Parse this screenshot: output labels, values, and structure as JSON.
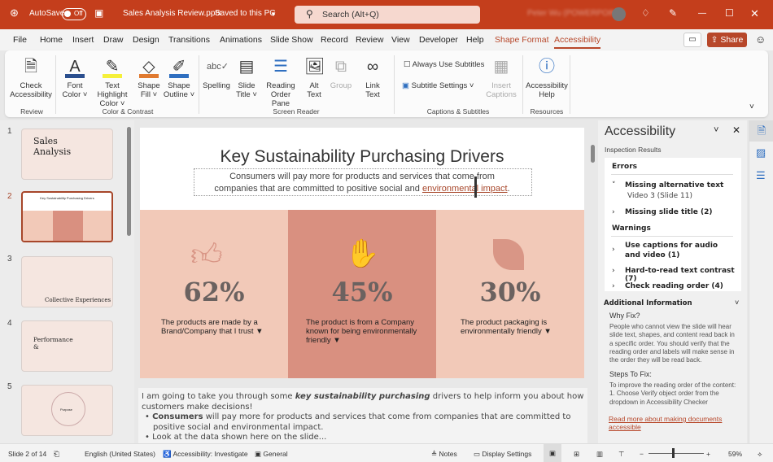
{
  "titlebar": {
    "autosave_label": "AutoSave",
    "autosave_state": "Off",
    "file_title": "Sales Analysis Review.pptx",
    "save_state": "Saved to this PC",
    "search_placeholder": "Search (Alt+Q)",
    "user_name": "Peter Wu (POWERPOINT)",
    "accent": "#c43e1c"
  },
  "tabs": [
    "File",
    "Home",
    "Insert",
    "Draw",
    "Design",
    "Transitions",
    "Animations",
    "Slide Show",
    "Record",
    "Review",
    "View",
    "Developer",
    "Help",
    "Shape Format",
    "Accessibility"
  ],
  "share_label": "Share",
  "ribbon": {
    "check": "Check Accessibility",
    "font_color": "Font Color",
    "highlight": "Text Highlight Color",
    "shape_fill": "Shape Fill",
    "shape_outline": "Shape Outline",
    "spelling": "Spelling",
    "slide_title": "Slide Title",
    "reading_order": "Reading Order Pane",
    "alt_text": "Alt Text",
    "group": "Group",
    "link_text": "Link Text",
    "always_subtitles": "Always Use Subtitles",
    "subtitle_settings": "Subtitle Settings",
    "insert_captions": "Insert Captions",
    "acc_help": "Accessibility Help",
    "groups": {
      "review": "Review",
      "color": "Color & Contrast",
      "screen_reader": "Screen Reader",
      "captions": "Captions & Subtitles",
      "resources": "Resources"
    }
  },
  "thumbnails": [
    {
      "num": "1",
      "title": "Sales Analysis"
    },
    {
      "num": "2",
      "title": "Key Sustainability Purchasing Drivers"
    },
    {
      "num": "3",
      "title": "Collective Experiences"
    },
    {
      "num": "4",
      "title": "Performance &"
    },
    {
      "num": "5",
      "title": "Purpose"
    }
  ],
  "slide": {
    "title": "Key Sustainability Purchasing Drivers",
    "subtitle_1": "Consumers will pay more for products and services that come from",
    "subtitle_2a": "companies that are committed to positive social and ",
    "subtitle_2b": "environmental impact",
    "subtitle_2c": ".",
    "panels": [
      {
        "pct": "62%",
        "desc": "The products are made by a Brand/Company that I trust ▼",
        "color": "#f2c9b8",
        "icon": "thumbs-up-icon"
      },
      {
        "pct": "45%",
        "desc": "The product is from a Company known for being environmentally friendly  ▼",
        "color": "#d99080",
        "icon": "hand-plant-icon"
      },
      {
        "pct": "30%",
        "desc": "The product packaging is environmentally friendly ▼",
        "color": "#f2c9b8",
        "icon": "leaf-icon"
      }
    ]
  },
  "notes": {
    "p1a": "I am going to take you through some ",
    "p1b": "key sustainability purchasing",
    "p1c": " drivers to help inform you about how customers make decisions!",
    "b1a": "Consumers",
    "b1b": " will pay more for products and services that come from companies that are committed to positive social and environmental impact.",
    "b2": "Look at the data shown here on the slide..."
  },
  "pane": {
    "title": "Accessibility",
    "inspection": "Inspection Results",
    "errors": "Errors",
    "e1": "Missing alternative text",
    "e1_sub": "Video 3  (Slide 11)",
    "e2": "Missing slide title (2)",
    "warnings": "Warnings",
    "w1": "Use captions for audio and video (1)",
    "w2": "Hard-to-read text contrast (7)",
    "w3": "Check reading order (4)",
    "additional": "Additional Information",
    "why": "Why Fix?",
    "why_text": "People who cannot view the slide will hear slide text, shapes, and content read back in a specific order. You should verify that the reading order and labels will make sense in the order they will be read back.",
    "steps": "Steps To Fix:",
    "steps_text": "To improve the reading order of the content: 1. Choose Verify object order from the dropdown in Accessibility Checker",
    "link": "Read more about making documents accessible"
  },
  "status": {
    "slide": "Slide 2 of 14",
    "language": "English (United States)",
    "accessibility": "Accessibility: Investigate",
    "sensitivity": "General",
    "notes": "Notes",
    "display": "Display Settings",
    "zoom": "59%"
  }
}
